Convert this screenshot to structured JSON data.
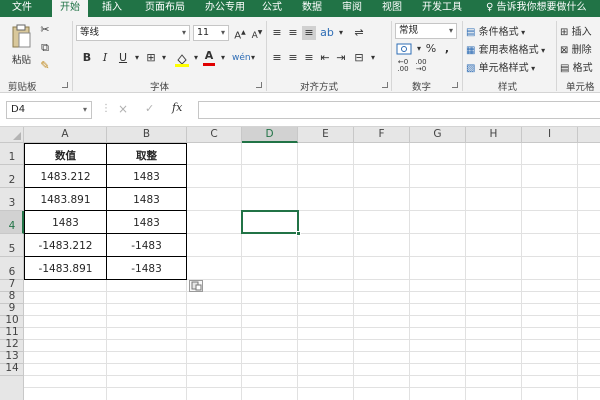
{
  "ribbon_tabs": [
    "文件",
    "开始",
    "插入",
    "页面布局",
    "办公专用",
    "公式",
    "数据",
    "审阅",
    "视图",
    "开发工具"
  ],
  "tell_me": "告诉我你想要做什么",
  "clipboard": {
    "paste_label": "粘贴",
    "group_label": "剪贴板"
  },
  "font": {
    "name": "等线",
    "size": "11",
    "group_label": "字体",
    "bold": "B",
    "italic": "I",
    "underline": "U"
  },
  "alignment": {
    "group_label": "对齐方式"
  },
  "number": {
    "format": "常规",
    "percent": "%",
    "comma": ",",
    "group_label": "数字"
  },
  "styles": {
    "conditional": "条件格式",
    "table": "套用表格格式",
    "cell_styles": "单元格样式",
    "group_label": "样式"
  },
  "cells": {
    "insert": "插入",
    "delete": "删除",
    "format": "格式",
    "group_label": "单元格"
  },
  "formula_bar": {
    "name_box": "D4",
    "fx": "fx",
    "cancel": "×",
    "enter": "✓",
    "formula": ""
  },
  "columns": [
    "A",
    "B",
    "C",
    "D",
    "E",
    "F",
    "G",
    "H",
    "I"
  ],
  "rows": [
    "1",
    "2",
    "3",
    "4",
    "5",
    "6",
    "7",
    "8",
    "9",
    "10",
    "11",
    "12",
    "13",
    "14"
  ],
  "selected_cell": {
    "column": "D",
    "row": "4"
  },
  "table": {
    "headers": [
      "数值",
      "取整"
    ],
    "rows": [
      [
        "1483.212",
        "1483"
      ],
      [
        "1483.891",
        "1483"
      ],
      [
        "1483",
        "1483"
      ],
      [
        "-1483.212",
        "-1483"
      ],
      [
        "-1483.891",
        "-1483"
      ]
    ]
  },
  "colors": {
    "accent": "#217346"
  }
}
